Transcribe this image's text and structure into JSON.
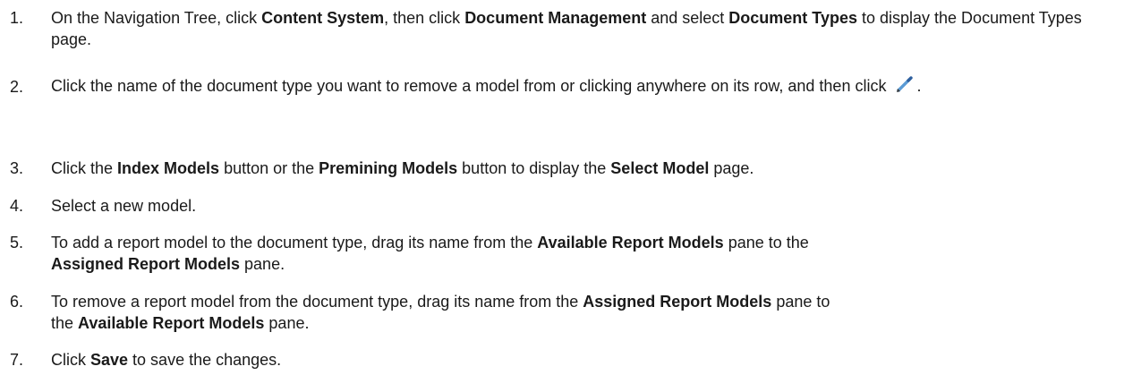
{
  "steps": [
    {
      "number": "1.",
      "parts": [
        {
          "text": "On the Navigation Tree, click "
        },
        {
          "text": "Content System",
          "bold": true
        },
        {
          "text": ", then click "
        },
        {
          "text": "Document Management",
          "bold": true
        },
        {
          "text": " and select "
        },
        {
          "text": "Document Types",
          "bold": true
        },
        {
          "text": " to display the Document Types page."
        }
      ]
    },
    {
      "number": "2.",
      "parts": [
        {
          "text": "Click the name of the document type you want to remove a model from or clicking anywhere on its row, and then click"
        },
        {
          "icon": "edit-pencil-icon"
        },
        {
          "text": "."
        }
      ]
    },
    {
      "number": "3.",
      "parts": [
        {
          "text": "Click the "
        },
        {
          "text": "Index Models",
          "bold": true
        },
        {
          "text": " button or the "
        },
        {
          "text": "Premining Models",
          "bold": true
        },
        {
          "text": " button to display the "
        },
        {
          "text": "Select Model",
          "bold": true
        },
        {
          "text": " page."
        }
      ]
    },
    {
      "number": "4.",
      "parts": [
        {
          "text": "Select a new model."
        }
      ]
    },
    {
      "number": "5.",
      "parts": [
        {
          "text": "To add a report model to the document type, drag its name from the "
        },
        {
          "text": "Available Report Models",
          "bold": true
        },
        {
          "text": " pane to the "
        },
        {
          "text": "Assigned Report Models",
          "bold": true
        },
        {
          "text": " pane."
        }
      ]
    },
    {
      "number": "6.",
      "parts": [
        {
          "text": "To remove a report model from the document type, drag its name from the "
        },
        {
          "text": "Assigned Report Models",
          "bold": true
        },
        {
          "text": " pane to the "
        },
        {
          "text": "Available Report Models",
          "bold": true
        },
        {
          "text": " pane."
        }
      ]
    },
    {
      "number": "7.",
      "parts": [
        {
          "text": "Click "
        },
        {
          "text": "Save",
          "bold": true
        },
        {
          "text": " to save the changes."
        }
      ]
    }
  ]
}
